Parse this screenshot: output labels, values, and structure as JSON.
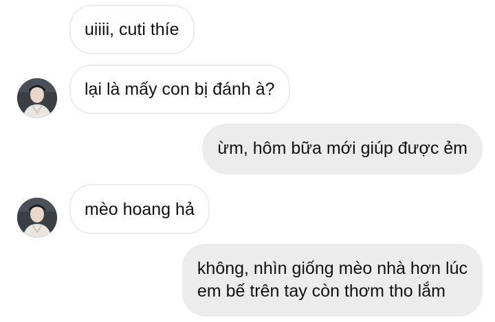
{
  "chat": {
    "messages": [
      {
        "sender": "other",
        "text": "uiiii, cuti thíe"
      },
      {
        "sender": "other",
        "text": "lại là mấy con bị đánh à?",
        "avatar": "user-avatar"
      },
      {
        "sender": "me",
        "text": "ừm, hôm bữa mới giúp được ẻm"
      },
      {
        "sender": "other",
        "text": "mèo hoang hả",
        "avatar": "user-avatar"
      },
      {
        "sender": "me",
        "lines": [
          "không, nhìn giống mèo nhà hơn lúc",
          "em bế trên tay còn thơm tho lắm"
        ]
      }
    ]
  },
  "colors": {
    "incoming_bg": "#ffffff",
    "incoming_border": "#ececec",
    "outgoing_bg": "#ececec",
    "text": "#111111"
  }
}
